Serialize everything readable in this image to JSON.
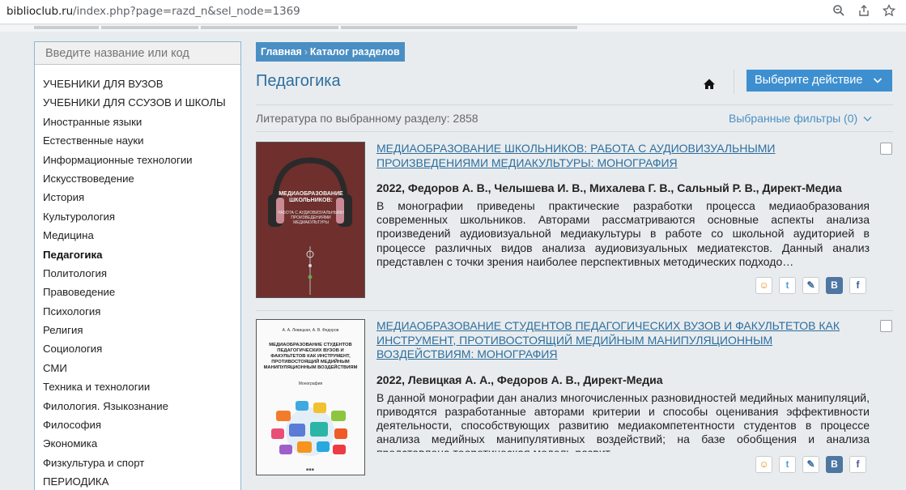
{
  "browser": {
    "url_domain": "biblioclub.ru",
    "url_rest": "/index.php?page=razd_n&sel_node=1369"
  },
  "sidebar": {
    "search_placeholder": "Введите название или код",
    "items": [
      {
        "label": "УЧЕБНИКИ ДЛЯ ВУЗОВ"
      },
      {
        "label": "УЧЕБНИКИ ДЛЯ ССУЗОВ И ШКОЛЫ"
      },
      {
        "label": "Иностранные языки"
      },
      {
        "label": "Естественные науки"
      },
      {
        "label": "Информационные технологии"
      },
      {
        "label": "Искусствоведение"
      },
      {
        "label": "История"
      },
      {
        "label": "Культурология"
      },
      {
        "label": "Медицина"
      },
      {
        "label": "Педагогика",
        "active": true
      },
      {
        "label": "Политология"
      },
      {
        "label": "Правоведение"
      },
      {
        "label": "Психология"
      },
      {
        "label": "Религия"
      },
      {
        "label": "Социология"
      },
      {
        "label": "СМИ"
      },
      {
        "label": "Техника и технологии"
      },
      {
        "label": "Филология. Языкознание"
      },
      {
        "label": "Философия"
      },
      {
        "label": "Экономика"
      },
      {
        "label": "Физкультура и спорт"
      },
      {
        "label": "ПЕРИОДИКА"
      }
    ]
  },
  "breadcrumb": {
    "home": "Главная",
    "catalog": "Каталог разделов"
  },
  "main": {
    "title": "Педагогика",
    "action_button": "Выберите действие",
    "count_text": "Литература по выбранному разделу: 2858",
    "filters_text": "Выбранные фильтры (0)"
  },
  "books": [
    {
      "title": "МЕДИАОБРАЗОВАНИЕ ШКОЛЬНИКОВ: РАБОТА С АУДИОВИЗУАЛЬНЫМИ ПРОИЗВЕДЕНИЯМИ МЕДИАКУЛЬТУРЫ: МОНОГРАФИЯ",
      "meta": "2022, Федоров А. В., Челышева И. В., Михалева Г. В., Сальный Р. В., Директ-Медиа",
      "description": "В монографии приведены практические разработки процесса медиаобразования современных школьников. Авторами рассматриваются основные аспекты анализа произведений аудиовизуальной медиакультуры в работе со школьной аудиторией в процессе различных видов анализа аудиовизуальных медиатекстов. Данный анализ представлен с точки зрения наиболее перспективных методических подходо…",
      "cover_title": "МЕДИАОБРАЗОВАНИЕ ШКОЛЬНИКОВ:",
      "cover_subtitle": "РАБОТА С АУДИОВИЗУАЛЬНЫМИ ПРОИЗВЕДЕНИЯМИ МЕДИАКУЛЬТУРЫ"
    },
    {
      "title": "МЕДИАОБРАЗОВАНИЕ СТУДЕНТОВ ПЕДАГОГИЧЕСКИХ ВУЗОВ И ФАКУЛЬТЕТОВ КАК ИНСТРУМЕНТ, ПРОТИВОСТОЯЩИЙ МЕДИЙНЫМ МАНИПУЛЯЦИОННЫМ ВОЗДЕЙСТВИЯМ: МОНОГРАФИЯ",
      "meta": "2022, Левицкая А. А., Федоров А. В., Директ-Медиа",
      "description": "В данной монографии дан анализ многочисленных разновидностей медийных манипуляций, приводятся разработанные авторами критерии и способы оценивания эффективности деятельности, способствующих развитию медиакомпетентности студентов в процессе анализа медийных манипулятивных воздействий; на базе обобщения и анализа представлена теоретическая модель развит…",
      "cover_authors": "А. А. Левицкая, А. В. Федоров",
      "cover_title": "МЕДИАОБРАЗОВАНИЕ СТУДЕНТОВ ПЕДАГОГИЧЕСКИХ ВУЗОВ И ФАКУЛЬТЕТОВ КАК ИНСТРУМЕНТ, ПРОТИВОСТОЯЩИЙ МЕДИЙНЫМ МАНИПУЛЯЦИОННЫМ ВОЗДЕЙСТВИЯМ",
      "cover_label": "Монография"
    }
  ],
  "colors": {
    "accent": "#3d8fd0",
    "link": "#2d6f9f",
    "cover1": "#6e2f2d"
  }
}
